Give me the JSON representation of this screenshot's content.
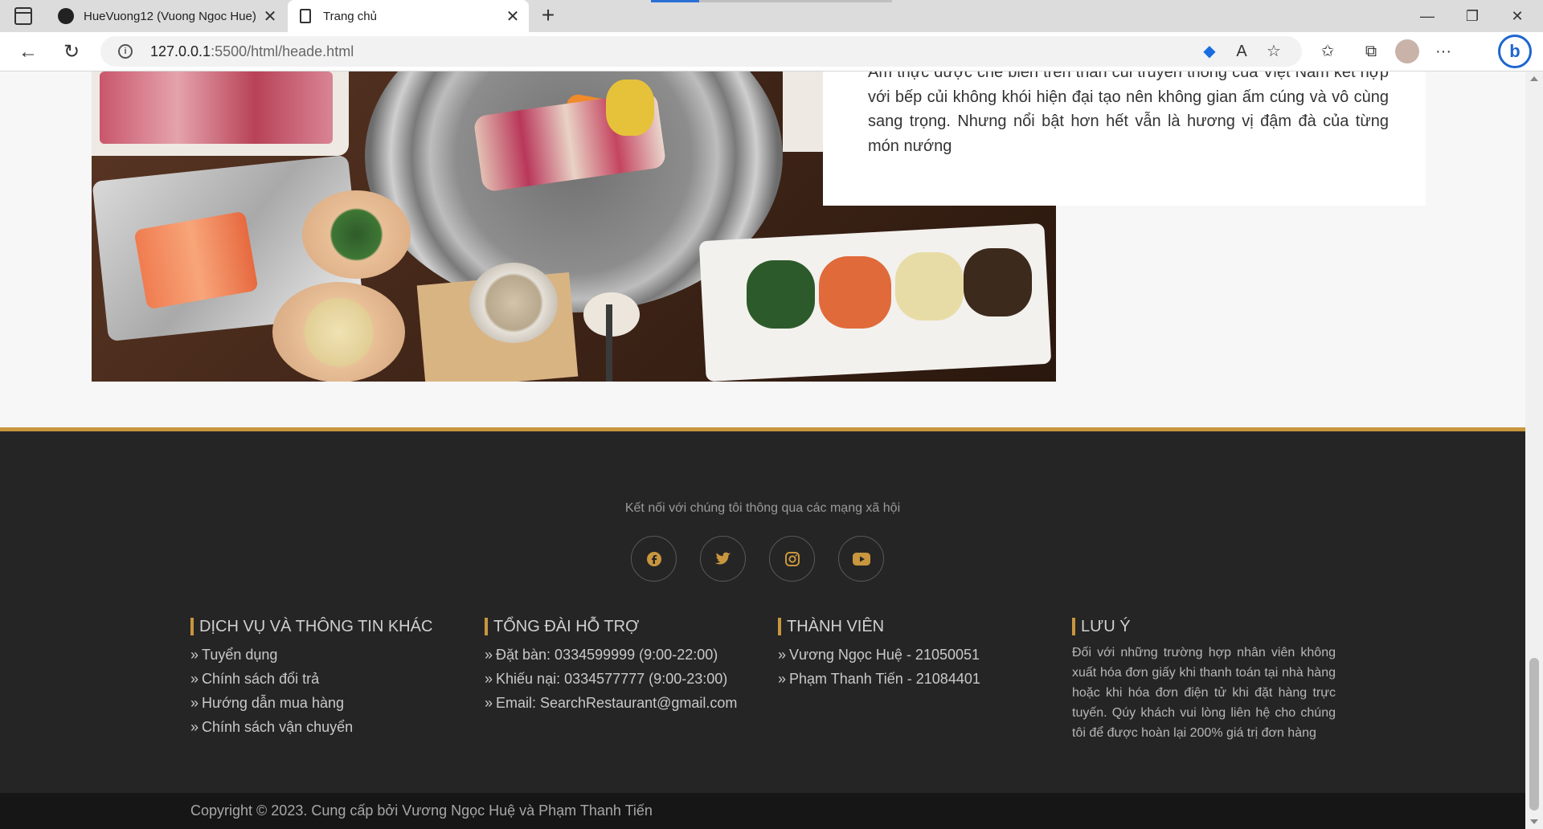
{
  "browser": {
    "tabs": [
      {
        "title": "HueVuong12 (Vuong Ngoc Hue)",
        "icon": "github-icon",
        "active": false
      },
      {
        "title": "Trang chủ",
        "icon": "document-icon",
        "active": true
      }
    ],
    "url_host": "127.0.0.1",
    "url_path": ":5500/html/heade.html"
  },
  "content": {
    "description": "Ẩm thực được chế biến trên than củi truyền thống của Việt Nam kết hợp với bếp củi không khói hiện đại tạo nên không gian ấm cúng và vô cùng sang trọng. Nhưng nổi bật hơn hết vẫn là hương vị đậm đà của từng món nướng"
  },
  "footer": {
    "connect_text": "Kết nối với chúng tôi thông qua các mạng xã hội",
    "socials": [
      "facebook-icon",
      "twitter-icon",
      "instagram-icon",
      "youtube-icon"
    ],
    "accent_color": "#c8963e",
    "columns": [
      {
        "title": "DỊCH VỤ VÀ THÔNG TIN KHÁC",
        "items": [
          "Tuyển dụng",
          "Chính sách đổi trả",
          "Hướng dẫn mua hàng",
          "Chính sách vận chuyển"
        ]
      },
      {
        "title": "TỔNG ĐÀI HỖ TRỢ",
        "items": [
          "Đặt bàn: 0334599999 (9:00-22:00)",
          "Khiếu nại: 0334577777 (9:00-23:00)",
          "Email: SearchRestaurant@gmail.com"
        ]
      },
      {
        "title": "THÀNH VIÊN",
        "items": [
          "Vương Ngọc Huệ - 21050051",
          "Phạm Thanh Tiến - 21084401"
        ]
      },
      {
        "title": "LƯU Ý",
        "note": "Đối với những trường hợp nhân viên không xuất hóa đơn giấy khi thanh toán tại nhà hàng hoặc khi hóa đơn điện tử khi đặt hàng trực tuyến. Qúy khách vui lòng liên hệ cho chúng tôi để được hoàn lại 200% giá trị đơn hàng"
      }
    ],
    "copyright": "Copyright © 2023. Cung cấp bởi Vương Ngọc Huệ và Phạm Thanh Tiến"
  }
}
